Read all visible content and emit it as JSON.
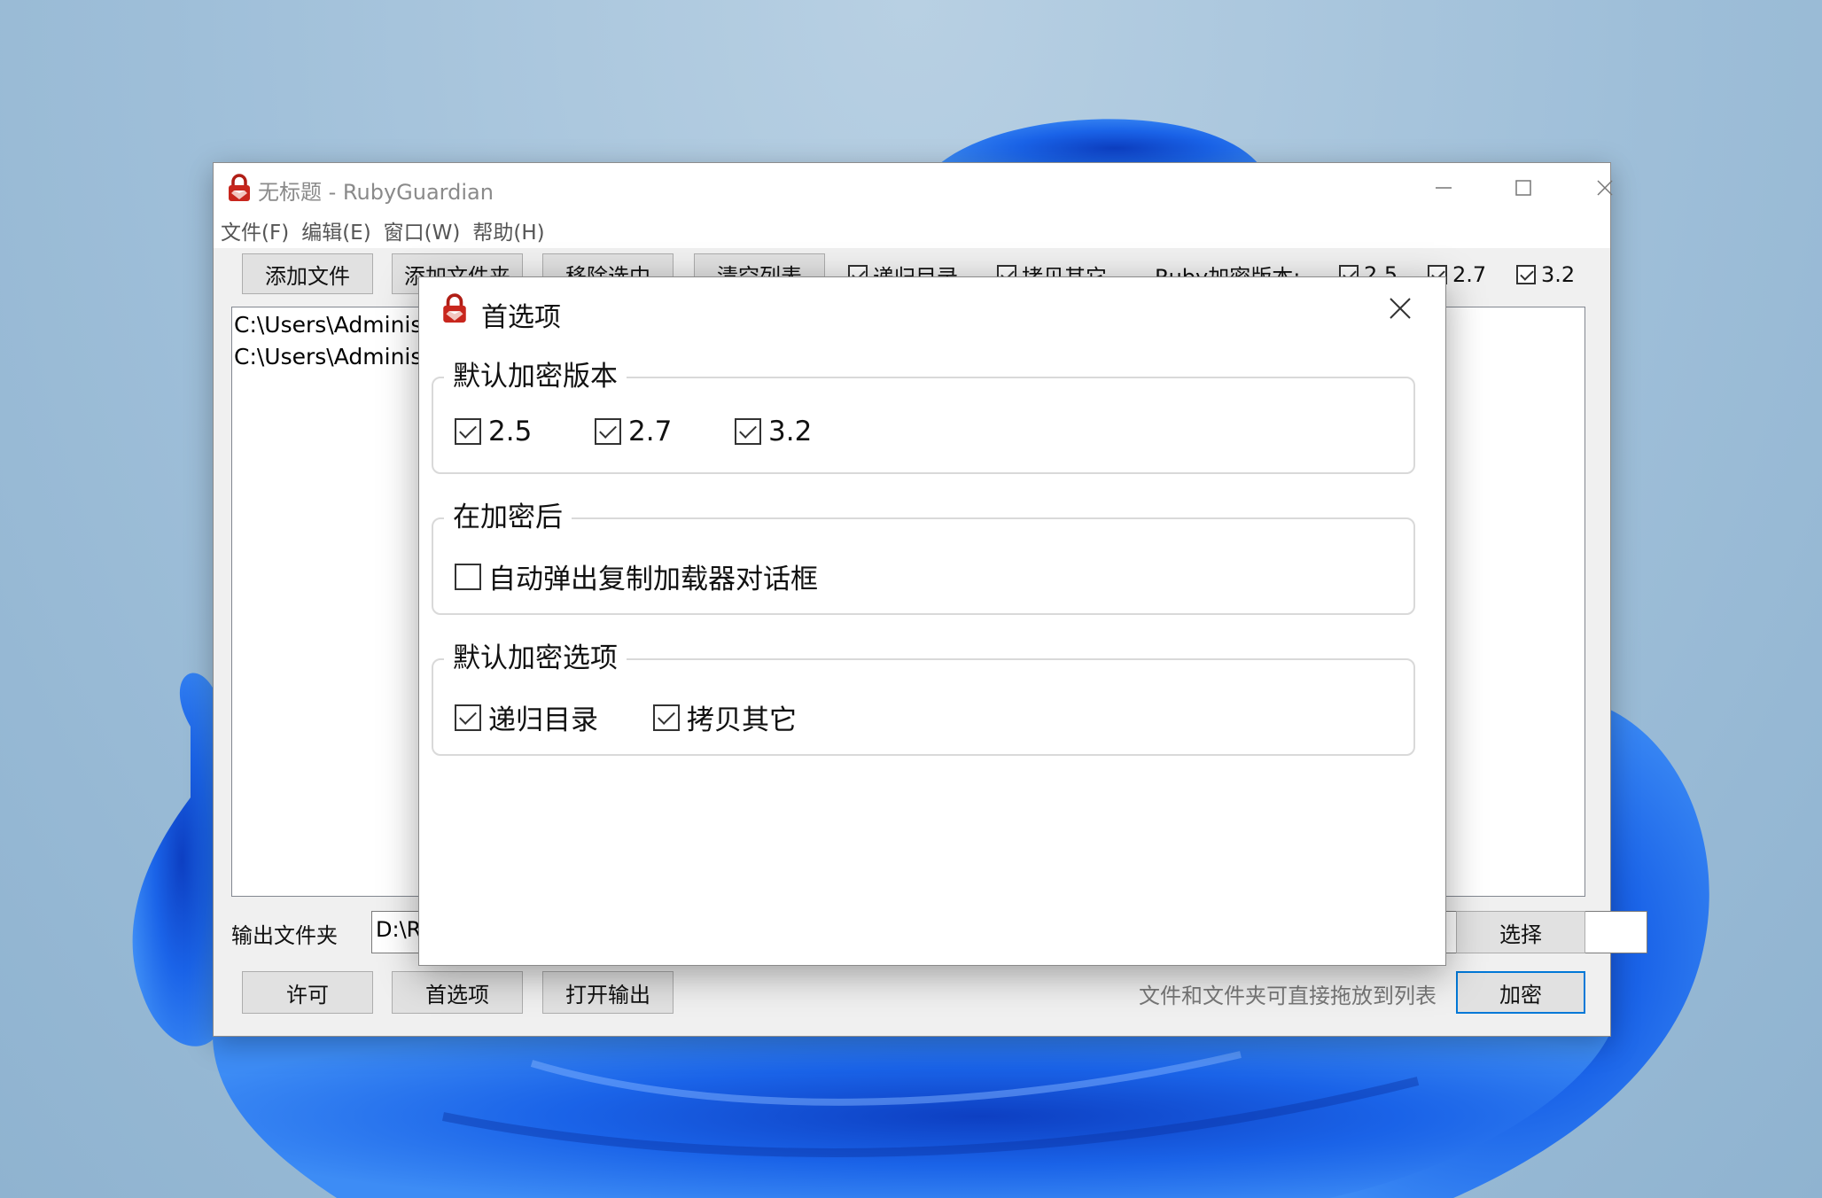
{
  "colors": {
    "accent": "#0078d7",
    "wallpaper": "#9fbfd9",
    "window_bg": "#f0f0f0",
    "bloom": "#1a5fe0"
  },
  "window": {
    "title": "无标题 - RubyGuardian",
    "icon": "ruby-lock-icon",
    "controls": {
      "minimize": "minimize-icon",
      "maximize": "maximize-icon",
      "close": "close-icon"
    }
  },
  "menu": [
    {
      "label": "文件(F)"
    },
    {
      "label": "编辑(E)"
    },
    {
      "label": "窗口(W)"
    },
    {
      "label": "帮助(H)"
    }
  ],
  "toolbar": {
    "add_file": "添加文件",
    "add_folder": "添加文件夹",
    "remove_selected": "移除选中",
    "clear_list": "清空列表",
    "recursive": {
      "label": "递归目录",
      "checked": true
    },
    "copy_others": {
      "label": "拷贝其它",
      "checked": true
    },
    "ruby_version_label": "Ruby加密版本:",
    "versions": [
      {
        "label": "2.5",
        "checked": true
      },
      {
        "label": "2.7",
        "checked": true
      },
      {
        "label": "3.2",
        "checked": true
      }
    ]
  },
  "file_list": [
    "C:\\Users\\Administ",
    "C:\\Users\\Administ"
  ],
  "output": {
    "label": "输出文件夹",
    "value": "D:\\R",
    "choose": "选择"
  },
  "bottom": {
    "license": "许可",
    "preferences": "首选项",
    "open_output": "打开输出",
    "hint": "文件和文件夹可直接拖放到列表",
    "encrypt": "加密"
  },
  "dialog": {
    "title": "首选项",
    "icon": "ruby-lock-icon",
    "close_icon": "close-icon",
    "groups": [
      {
        "title": "默认加密版本",
        "options": [
          {
            "label": "2.5",
            "checked": true
          },
          {
            "label": "2.7",
            "checked": true
          },
          {
            "label": "3.2",
            "checked": true
          }
        ]
      },
      {
        "title": "在加密后",
        "options": [
          {
            "label": "自动弹出复制加载器对话框",
            "checked": false
          }
        ]
      },
      {
        "title": "默认加密选项",
        "options": [
          {
            "label": "递归目录",
            "checked": true
          },
          {
            "label": "拷贝其它",
            "checked": true
          }
        ]
      }
    ]
  }
}
